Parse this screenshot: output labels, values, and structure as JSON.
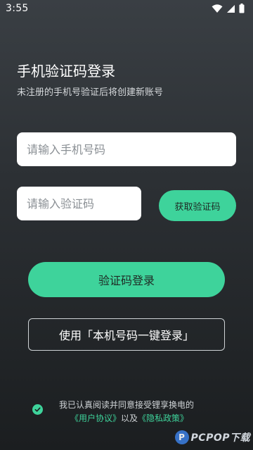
{
  "status_bar": {
    "time": "3:55",
    "icons": [
      "wifi-icon",
      "cell-signal-icon",
      "battery-icon"
    ]
  },
  "header": {
    "title": "手机验证码登录",
    "subtitle": "未注册的手机号验证后将创建新账号"
  },
  "form": {
    "phone_placeholder": "请输入手机号码",
    "phone_value": "",
    "code_placeholder": "请输入验证码",
    "code_value": "",
    "get_code_label": "获取验证码"
  },
  "actions": {
    "login_label": "验证码登录",
    "onekey_label": "使用「本机号码一键登录」"
  },
  "agreement": {
    "checked": true,
    "text_line1": "我已认真阅读并同意接受锂享换电的",
    "user_agreement": "《用户协议》",
    "conjunction": "以及",
    "privacy_policy": "《隐私政策》"
  },
  "watermark": {
    "text": "PCPOP下载"
  },
  "colors": {
    "accent": "#3ed39b",
    "background_top": "#3a3f44",
    "background_bottom": "#1b1e20"
  }
}
